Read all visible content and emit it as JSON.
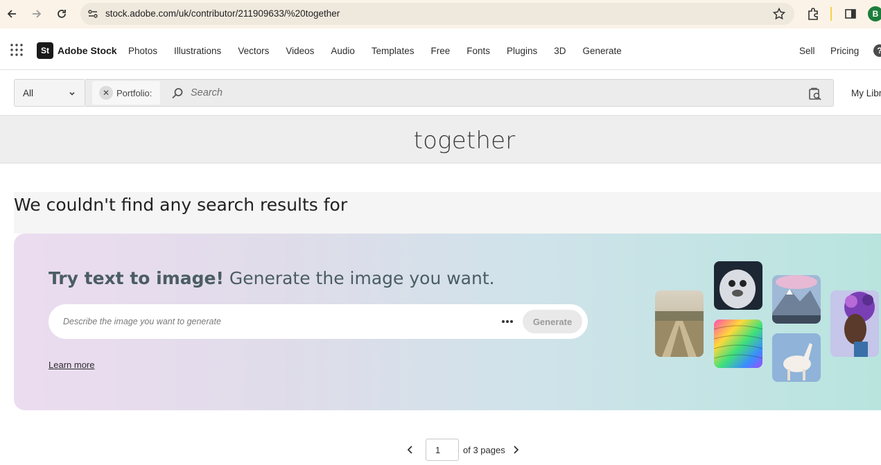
{
  "browser": {
    "url": "stock.adobe.com/uk/contributor/211909633/%20together",
    "profile_initial": "B",
    "icons": [
      "back-icon",
      "forward-icon",
      "reload-icon",
      "site-settings-icon",
      "star-icon",
      "extensions-icon",
      "sidebar-icon"
    ]
  },
  "header": {
    "logo_mark": "St",
    "logo_name": "Adobe Stock",
    "nav": [
      "Photos",
      "Illustrations",
      "Vectors",
      "Videos",
      "Audio",
      "Templates",
      "Free",
      "Fonts",
      "Plugins",
      "3D",
      "Generate"
    ],
    "sell": "Sell",
    "pricing": "Pricing",
    "help": "?"
  },
  "search": {
    "filter_value": "All",
    "chip_label": "Portfolio:",
    "placeholder": "Search",
    "my_library": "My Libr"
  },
  "query": {
    "term": "together"
  },
  "results": {
    "no_results_message": "We couldn't find any search results for"
  },
  "promo": {
    "headline_bold": "Try text to image!",
    "headline_rest": " Generate the image you want.",
    "input_placeholder": "Describe the image you want to generate",
    "generate_label": "Generate",
    "learn_more": "Learn more"
  },
  "pagination": {
    "current_page": "1",
    "total_label": "of 3 pages"
  },
  "colors": {
    "brand_dark": "#1a1a1a",
    "profile_green": "#1c7d3b",
    "promo_text": "#4a5d63"
  }
}
